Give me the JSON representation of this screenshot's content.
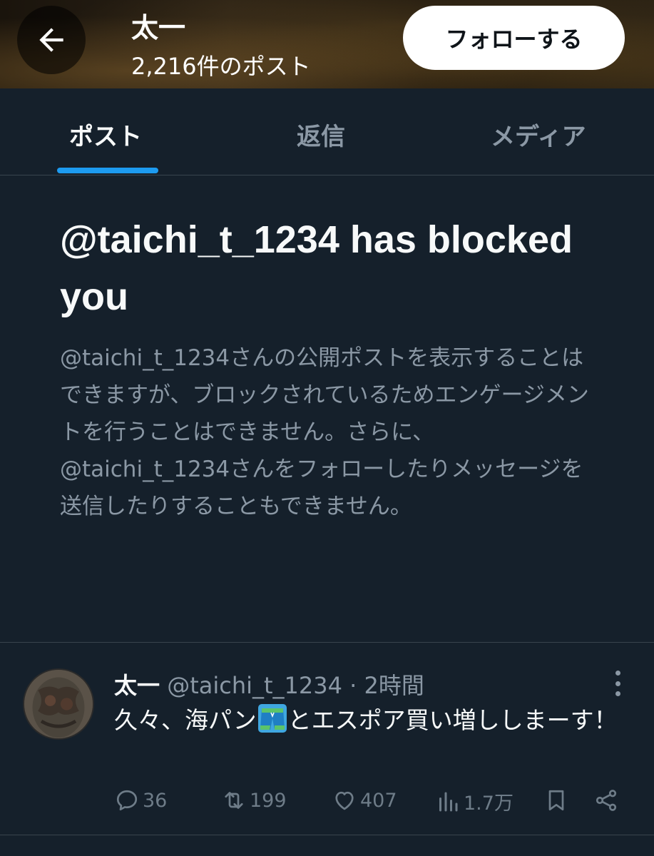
{
  "header": {
    "back_label": "Back",
    "name": "太一",
    "post_count": "2,216件のポスト",
    "follow_label": "フォローする"
  },
  "tabs": [
    {
      "label": "ポスト",
      "active": true
    },
    {
      "label": "返信",
      "active": false
    },
    {
      "label": "メディア",
      "active": false
    }
  ],
  "blocked": {
    "title": "@taichi_t_1234 has blocked you",
    "description": "@taichi_t_1234さんの公開ポストを表示することはできますが、ブロックされているためエンゲージメントを行うことはできません。さらに、@taichi_t_1234さんをフォローしたりメッセージを送信したりすることもできません。"
  },
  "post": {
    "name": "太一",
    "handle": "@taichi_t_1234",
    "separator": "·",
    "time": "2時間",
    "text_before": "久々、海パン",
    "text_after": "とエスポア買い増ししまーす！",
    "emoji": "shorts-icon",
    "stats": {
      "replies": "36",
      "reposts": "199",
      "likes": "407",
      "views": "1.7万"
    }
  },
  "colors": {
    "background": "#15202b",
    "accent": "#1d9bf0",
    "secondary_text": "#8b98a5",
    "divider": "#38444d"
  }
}
